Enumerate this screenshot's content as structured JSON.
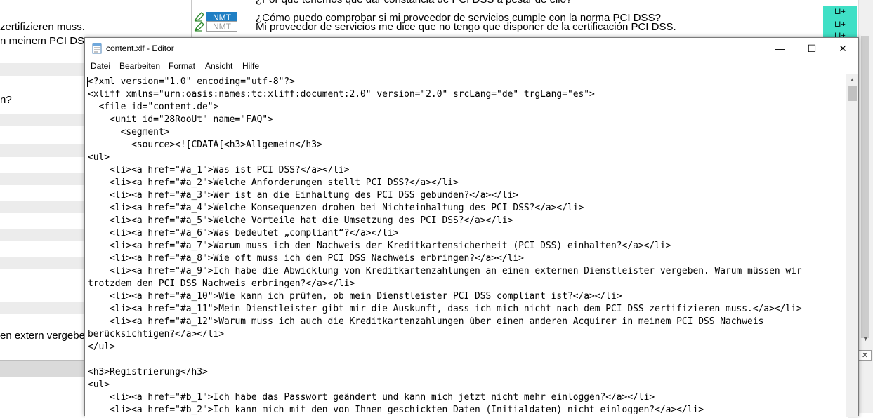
{
  "background": {
    "rows": [
      {
        "source": "",
        "badge": "",
        "target": "¿Por qué tenemos que dar constancia de PCI DSS a pesar de ello?",
        "status": ""
      },
      {
        "source": "",
        "badge": "NMT",
        "badge_active": true,
        "target": "¿Cómo puedo comprobar si mi proveedor de servicios cumple con la norma PCI DSS?",
        "status": "LI+"
      },
      {
        "source": "zertifizieren muss.",
        "badge": "NMT",
        "badge_active": false,
        "target": "Mi proveedor de servicios me dice que no tengo que disponer de la certificación PCI DSS.",
        "status": "LI+"
      },
      {
        "source": "n meinem PCI DS",
        "badge": "",
        "target": "",
        "status": "LI+"
      }
    ],
    "side_fragments": [
      {
        "text": "n?"
      },
      {
        "text": "en extern vergebe"
      }
    ],
    "close_box": "✕"
  },
  "window": {
    "title": "content.xlf - Editor",
    "icon": "notepad-icon",
    "controls": {
      "minimize": "—",
      "maximize": "☐",
      "close": "✕"
    }
  },
  "menu": [
    {
      "label": "Datei"
    },
    {
      "label": "Bearbeiten"
    },
    {
      "label": "Format"
    },
    {
      "label": "Ansicht"
    },
    {
      "label": "Hilfe"
    }
  ],
  "editor": {
    "lines": [
      "<?xml version=\"1.0\" encoding=\"utf-8\"?>",
      "<xliff xmlns=\"urn:oasis:names:tc:xliff:document:2.0\" version=\"2.0\" srcLang=\"de\" trgLang=\"es\">",
      "  <file id=\"content.de\">",
      "    <unit id=\"28RooUt\" name=\"FAQ\">",
      "      <segment>",
      "        <source><![CDATA[<h3>Allgemein</h3>",
      "<ul>",
      "    <li><a href=\"#a_1\">Was ist PCI DSS?</a></li>",
      "    <li><a href=\"#a_2\">Welche Anforderungen stellt PCI DSS?</a></li>",
      "    <li><a href=\"#a_3\">Wer ist an die Einhaltung des PCI DSS gebunden?</a></li>",
      "    <li><a href=\"#a_4\">Welche Konsequenzen drohen bei Nichteinhaltung des PCI DSS?</a></li>",
      "    <li><a href=\"#a_5\">Welche Vorteile hat die Umsetzung des PCI DSS?</a></li>",
      "    <li><a href=\"#a_6\">Was bedeutet „compliant“?</a></li>",
      "    <li><a href=\"#a_7\">Warum muss ich den Nachweis der Kreditkartensicherheit (PCI DSS) einhalten?</a></li>",
      "    <li><a href=\"#a_8\">Wie oft muss ich den PCI DSS Nachweis erbringen?</a></li>",
      "    <li><a href=\"#a_9\">Ich habe die Abwicklung von Kreditkartenzahlungen an einen externen Dienstleister vergeben. Warum müssen wir",
      "trotzdem den PCI DSS Nachweis erbringen?</a></li>",
      "    <li><a href=\"#a_10\">Wie kann ich prüfen, ob mein Dienstleister PCI DSS compliant ist?</a></li>",
      "    <li><a href=\"#a_11\">Mein Dienstleister gibt mir die Auskunft, dass ich mich nicht nach dem PCI DSS zertifizieren muss.</a></li>",
      "    <li><a href=\"#a_12\">Warum muss ich auch die Kreditkartenzahlungen über einen anderen Acquirer in meinem PCI DSS Nachweis",
      "berücksichtigen?</a></li>",
      "</ul>",
      "",
      "<h3>Registrierung</h3>",
      "<ul>",
      "    <li><a href=\"#b_1\">Ich habe das Passwort geändert und kann mich jetzt nicht mehr einloggen?</a></li>",
      "    <li><a href=\"#b_2\">Ich kann mich mit den von Ihnen geschickten Daten (Initialdaten) nicht einloggen?</a></li>"
    ]
  }
}
